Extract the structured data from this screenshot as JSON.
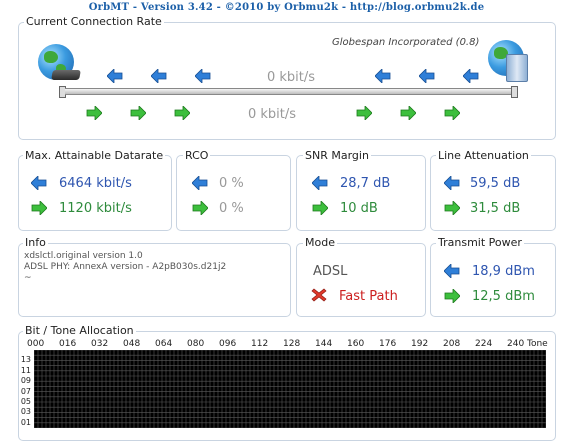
{
  "header": {
    "title": "OrbMT - Version 3.42 - ©2010 by Orbmu2k - http://blog.orbmu2k.de"
  },
  "connection": {
    "label": "Current Connection Rate",
    "chipset": "Globespan Incorporated (0.8)",
    "down_rate": "0 kbit/s",
    "up_rate": "0 kbit/s"
  },
  "datarate": {
    "label": "Max. Attainable Datarate",
    "down": "6464 kbit/s",
    "up": "1120 kbit/s"
  },
  "rco": {
    "label": "RCO",
    "down": "0 %",
    "up": "0 %"
  },
  "snr": {
    "label": "SNR Margin",
    "down": "28,7 dB",
    "up": "10 dB"
  },
  "attenuation": {
    "label": "Line Attenuation",
    "down": "59,5 dB",
    "up": "31,5 dB"
  },
  "info": {
    "label": "Info",
    "line1": "xdslctl.original version 1.0",
    "line2": "ADSL PHY: AnnexA version - A2pB030s.d21j2",
    "line3": "~"
  },
  "mode": {
    "label": "Mode",
    "standard": "ADSL",
    "path": "Fast Path"
  },
  "power": {
    "label": "Transmit Power",
    "down": "18,9 dBm",
    "up": "12,5 dBm"
  },
  "colors": {
    "down_arrow": "#2f7fd8",
    "up_arrow": "#3dbf3d",
    "upstream_bits": "#4ee44e",
    "downstream_bits": "#2f5fd0",
    "grid_bg": "#000000"
  },
  "chart_data": {
    "type": "bar",
    "title": "Bit / Tone Allocation",
    "xlabel": "Tone",
    "ylabel": "",
    "x_ticks": [
      "000",
      "016",
      "032",
      "048",
      "064",
      "080",
      "096",
      "112",
      "128",
      "144",
      "160",
      "176",
      "192",
      "208",
      "224",
      "240"
    ],
    "y_ticks": [
      "01",
      "03",
      "05",
      "07",
      "09",
      "11",
      "13"
    ],
    "xlim": [
      0,
      255
    ],
    "ylim": [
      0,
      15
    ],
    "grid": true,
    "series": []
  }
}
